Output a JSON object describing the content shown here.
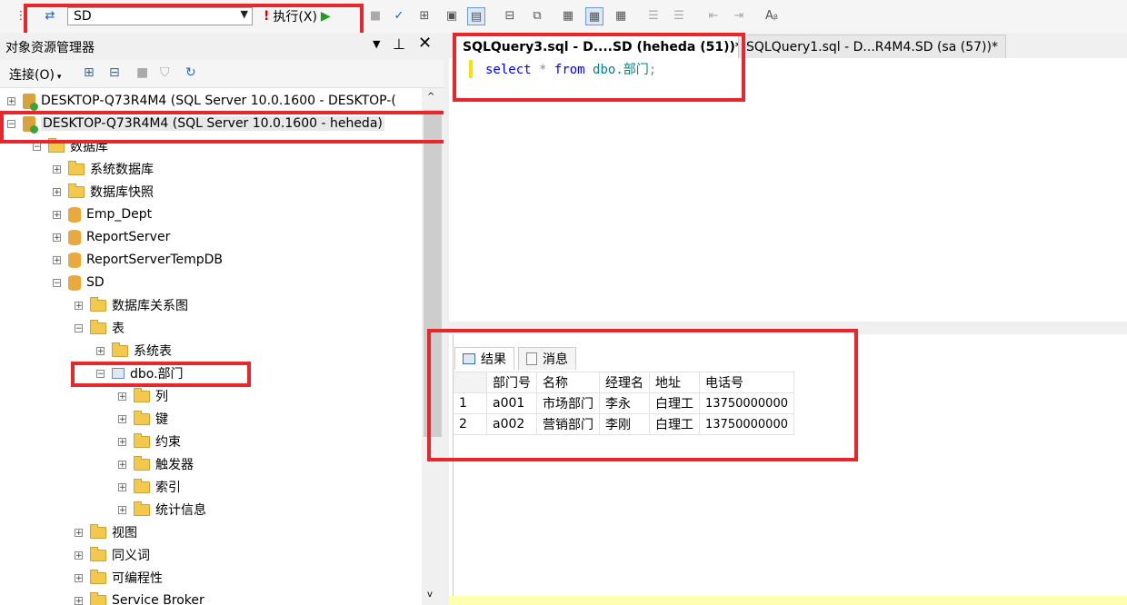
{
  "toolbar": {
    "database": "SD",
    "execute_label": "执行(X)"
  },
  "object_explorer": {
    "title": "对象资源管理器",
    "connect_label": "连接(O)",
    "nodes": [
      {
        "label": "DESKTOP-Q73R4M4 (SQL Server 10.0.1600 - DESKTOP-(",
        "type": "server",
        "exp": "+"
      },
      {
        "label": "DESKTOP-Q73R4M4 (SQL Server 10.0.1600 - heheda)",
        "type": "server",
        "exp": "-"
      },
      {
        "label": "数据库",
        "type": "folder",
        "exp": "-"
      },
      {
        "label": "系统数据库",
        "type": "folder",
        "exp": "+"
      },
      {
        "label": "数据库快照",
        "type": "folder",
        "exp": "+"
      },
      {
        "label": "Emp_Dept",
        "type": "db",
        "exp": "+"
      },
      {
        "label": "ReportServer",
        "type": "db",
        "exp": "+"
      },
      {
        "label": "ReportServerTempDB",
        "type": "db",
        "exp": "+"
      },
      {
        "label": "SD",
        "type": "db",
        "exp": "-"
      },
      {
        "label": "数据库关系图",
        "type": "folder",
        "exp": "+"
      },
      {
        "label": "表",
        "type": "folder",
        "exp": "-"
      },
      {
        "label": "系统表",
        "type": "folder",
        "exp": "+"
      },
      {
        "label": "dbo.部门",
        "type": "table",
        "exp": "-"
      },
      {
        "label": "列",
        "type": "folder",
        "exp": "+"
      },
      {
        "label": "键",
        "type": "folder",
        "exp": "+"
      },
      {
        "label": "约束",
        "type": "folder",
        "exp": "+"
      },
      {
        "label": "触发器",
        "type": "folder",
        "exp": "+"
      },
      {
        "label": "索引",
        "type": "folder",
        "exp": "+"
      },
      {
        "label": "统计信息",
        "type": "folder",
        "exp": "+"
      },
      {
        "label": "视图",
        "type": "folder",
        "exp": "+"
      },
      {
        "label": "同义词",
        "type": "folder",
        "exp": "+"
      },
      {
        "label": "可编程性",
        "type": "folder",
        "exp": "+"
      },
      {
        "label": "Service Broker",
        "type": "folder",
        "exp": "+"
      }
    ]
  },
  "tabs": [
    {
      "label": "SQLQuery3.sql - D....SD (heheda (51))*",
      "active": true
    },
    {
      "label": "SQLQuery1.sql - D...R4M4.SD (sa (57))*",
      "active": false
    }
  ],
  "editor": {
    "kw_select": "select",
    "star": "*",
    "kw_from": "from",
    "object": "dbo.部门",
    "semicolon": ";"
  },
  "results": {
    "tab_results": "结果",
    "tab_messages": "消息",
    "columns": [
      "部门号",
      "名称",
      "经理名",
      "地址",
      "电话号"
    ],
    "rows": [
      {
        "num": "1",
        "cells": [
          "a001",
          "市场部门",
          "李永",
          "白理工",
          "13750000000"
        ]
      },
      {
        "num": "2",
        "cells": [
          "a002",
          "营销部门",
          "李刚",
          "白理工",
          "13750000000"
        ]
      }
    ]
  },
  "colors": {
    "annotation": "#e8262b",
    "keyword": "#0000ff",
    "object": "#008080"
  }
}
